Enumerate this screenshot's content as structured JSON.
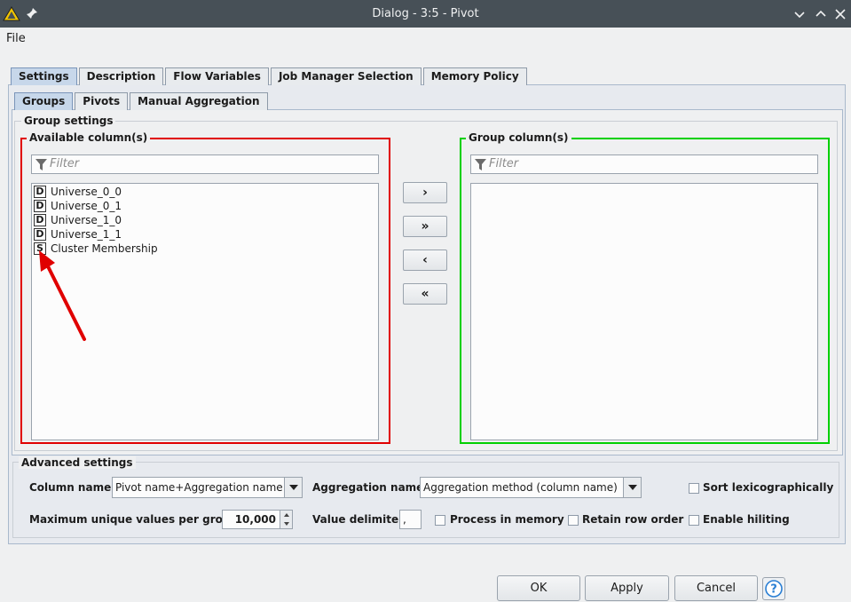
{
  "window": {
    "title": "Dialog - 3:5 - Pivot"
  },
  "menu": {
    "file": "File"
  },
  "main_tabs": [
    {
      "label": "Settings",
      "active": true
    },
    {
      "label": "Description"
    },
    {
      "label": "Flow Variables"
    },
    {
      "label": "Job Manager Selection"
    },
    {
      "label": "Memory Policy"
    }
  ],
  "sub_tabs": [
    {
      "label": "Groups",
      "active": true
    },
    {
      "label": "Pivots"
    },
    {
      "label": "Manual Aggregation"
    }
  ],
  "group_settings": {
    "legend": "Group settings",
    "available": {
      "legend": "Available column(s)",
      "filter_placeholder": "Filter",
      "items": [
        {
          "type": "D",
          "name": "Universe_0_0"
        },
        {
          "type": "D",
          "name": "Universe_0_1"
        },
        {
          "type": "D",
          "name": "Universe_1_0"
        },
        {
          "type": "D",
          "name": "Universe_1_1"
        },
        {
          "type": "S",
          "name": "Cluster Membership"
        }
      ]
    },
    "group": {
      "legend": "Group column(s)",
      "filter_placeholder": "Filter",
      "items": []
    },
    "movers": {
      "add": "›",
      "add_all": "»",
      "remove": "‹",
      "remove_all": "«"
    }
  },
  "advanced": {
    "legend": "Advanced settings",
    "column_name_label": "Column name:",
    "column_name_value": "Pivot name+Aggregation name",
    "aggregation_name_label": "Aggregation name:",
    "aggregation_name_value": "Aggregation method (column name)",
    "sort_label": "Sort lexicographically",
    "max_unique_label": "Maximum unique values per group",
    "max_unique_value": "10,000",
    "value_delimiter_label": "Value delimiter",
    "value_delimiter_value": ",",
    "process_in_memory_label": "Process in memory",
    "retain_row_order_label": "Retain row order",
    "enable_hiliting_label": "Enable hiliting"
  },
  "buttons": {
    "ok": "OK",
    "apply": "Apply",
    "cancel": "Cancel"
  },
  "colors": {
    "titlebar": "#475057",
    "available_border": "#e00000",
    "group_border": "#00d000",
    "annotation_arrow": "#e00000"
  }
}
